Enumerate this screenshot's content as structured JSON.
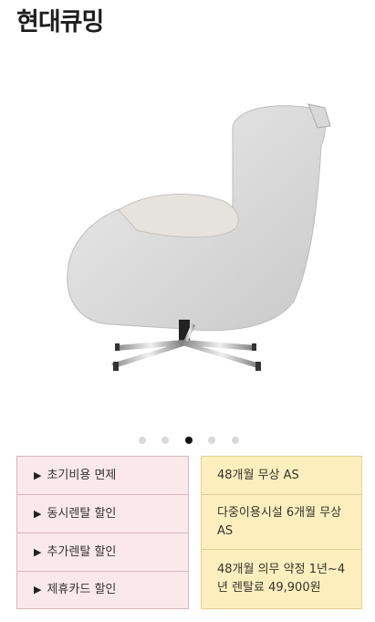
{
  "header": {
    "title": "현대큐밍"
  },
  "hero": {
    "image_alt": "massage-chair-product-image"
  },
  "carousel": {
    "count": 5,
    "active_index": 2
  },
  "benefits": {
    "items": [
      {
        "label": "초기비용 면제"
      },
      {
        "label": "동시렌탈 할인"
      },
      {
        "label": "추가렌탈 할인"
      },
      {
        "label": "제휴카드 할인"
      }
    ]
  },
  "details": {
    "items": [
      {
        "text": "48개월 무상 AS"
      },
      {
        "text": "다중이용시설 6개월 무상 AS"
      },
      {
        "text": "48개월 의무 약정 1년~4년 렌탈료 49,900원"
      }
    ]
  },
  "colors": {
    "benefit_bg": "#fbe8ea",
    "detail_bg": "#fdefbd",
    "active_dot": "#111111"
  }
}
